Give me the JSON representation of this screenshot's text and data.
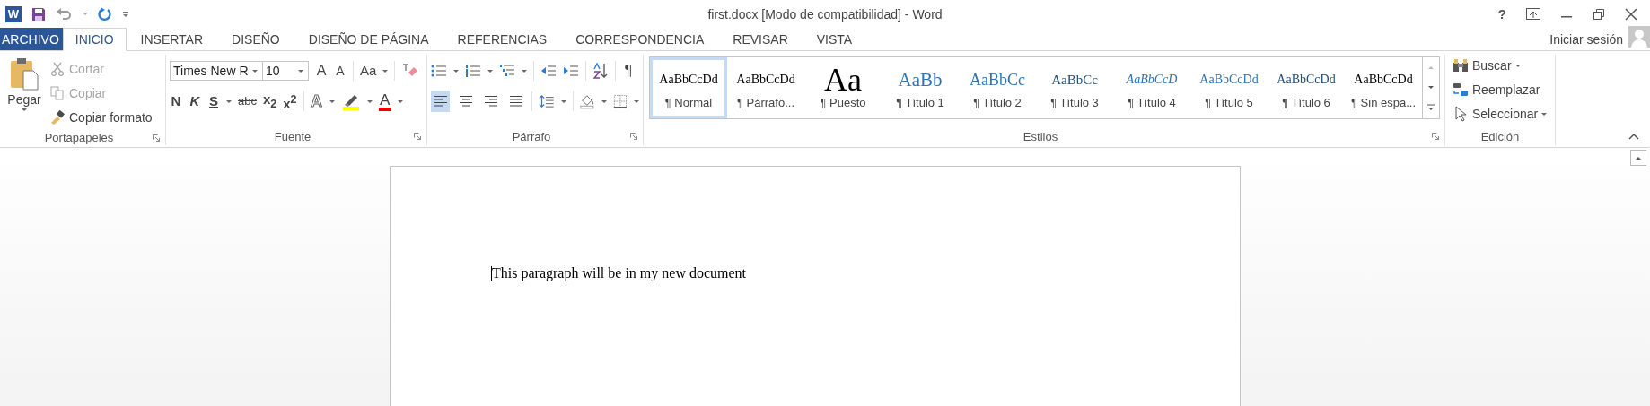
{
  "window": {
    "logo": "W",
    "title": "first.docx [Modo de compatibilidad] - Word",
    "help": "?"
  },
  "tabs": [
    {
      "label": "ARCHIVO",
      "kind": "file",
      "selected": false
    },
    {
      "label": "INICIO",
      "kind": "tab",
      "selected": true
    },
    {
      "label": "INSERTAR",
      "kind": "tab",
      "selected": false
    },
    {
      "label": "DISEÑO",
      "kind": "tab",
      "selected": false
    },
    {
      "label": "DISEÑO DE PÁGINA",
      "kind": "tab",
      "selected": false
    },
    {
      "label": "REFERENCIAS",
      "kind": "tab",
      "selected": false
    },
    {
      "label": "CORRESPONDENCIA",
      "kind": "tab",
      "selected": false
    },
    {
      "label": "REVISAR",
      "kind": "tab",
      "selected": false
    },
    {
      "label": "VISTA",
      "kind": "tab",
      "selected": false
    }
  ],
  "account": {
    "label": "Iniciar sesión"
  },
  "clipboard": {
    "label": "Portapapeles",
    "paste": "Pegar",
    "actions": [
      {
        "label": "Cortar",
        "kind": "cut",
        "disabled": true
      },
      {
        "label": "Copiar",
        "kind": "copy",
        "disabled": true
      },
      {
        "label": "Copiar formato",
        "kind": "format",
        "disabled": false
      }
    ]
  },
  "font": {
    "label": "Fuente",
    "font_name": "Times New R",
    "font_size": "10",
    "grow": "A",
    "shrink": "A",
    "change_case": "Aa",
    "bold": "N",
    "italic": "K",
    "underline": "S",
    "strikethrough": "abc",
    "subscript": "x$_{2}$",
    "superscript": "x$^{2}$",
    "text_effects": "A",
    "font_color": "A"
  },
  "paragraph": {
    "label": "Párrafo",
    "pilcrow": "¶",
    "alignments": [
      {
        "kind": "left",
        "selected": true
      },
      {
        "kind": "center",
        "selected": false
      },
      {
        "kind": "right",
        "selected": false
      },
      {
        "kind": "justify",
        "selected": false
      }
    ]
  },
  "styles": {
    "label": "Estilos",
    "items": [
      {
        "sample": "AaBbCcDd",
        "name": "¶ Normal",
        "kind": "normal",
        "selected": true
      },
      {
        "sample": "AaBbCcDd",
        "name": "¶ Párrafo...",
        "kind": "plain",
        "selected": false
      },
      {
        "sample": "Aa",
        "name": "¶ Puesto",
        "kind": "title",
        "selected": false
      },
      {
        "sample": "AaBb",
        "name": "¶ Título 1",
        "kind": "h1",
        "selected": false
      },
      {
        "sample": "AaBbCc",
        "name": "¶ Título 2",
        "kind": "h2",
        "selected": false
      },
      {
        "sample": "AaBbCc",
        "name": "¶ Título 3",
        "kind": "h3",
        "selected": false
      },
      {
        "sample": "AaBbCcD",
        "name": "¶ Título 4",
        "kind": "h4",
        "selected": false
      },
      {
        "sample": "AaBbCcDd",
        "name": "¶ Título 5",
        "kind": "h5",
        "selected": false
      },
      {
        "sample": "AaBbCcDd",
        "name": "¶ Título 6",
        "kind": "h6",
        "selected": false
      },
      {
        "sample": "AaBbCcDd",
        "name": "¶ Sin espa...",
        "kind": "plain",
        "selected": false
      }
    ]
  },
  "editing": {
    "label": "Edición",
    "actions": [
      {
        "label": "Buscar",
        "kind": "find",
        "dropdown": true
      },
      {
        "label": "Reemplazar",
        "kind": "replace",
        "dropdown": false
      },
      {
        "label": "Seleccionar",
        "kind": "select",
        "dropdown": true
      }
    ]
  },
  "document": {
    "paragraph": "This paragraph will be in my new document"
  }
}
